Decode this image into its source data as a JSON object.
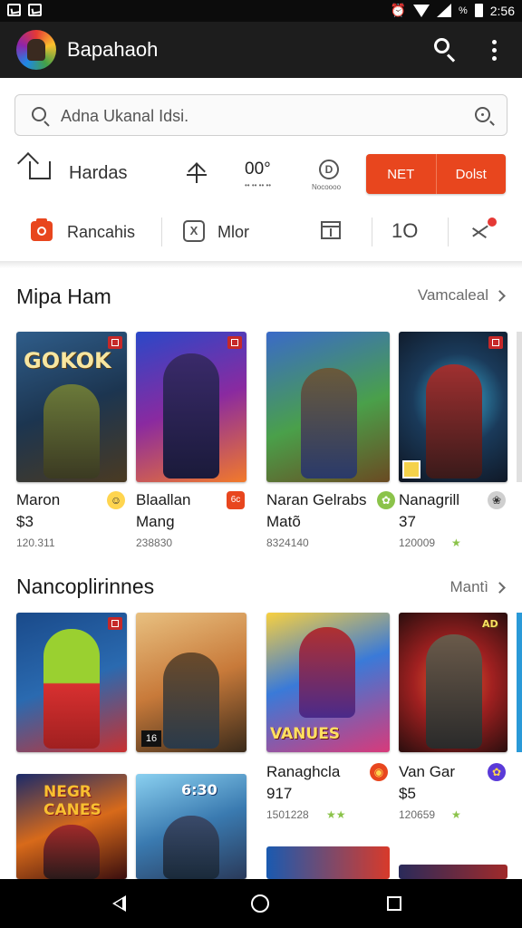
{
  "status_bar": {
    "time": "2:56",
    "battery": "%"
  },
  "app_bar": {
    "title": "Bapahaoh"
  },
  "search": {
    "placeholder": "Adna Ukanal Idsi."
  },
  "toolbar": {
    "home_label": "Hardas",
    "counter_text": "00°",
    "counter_sub": "•• •• •• ••",
    "d_icon": "D",
    "d_sub": "Nocoooo",
    "button_left": "NET",
    "button_right": "Dolst"
  },
  "categories": {
    "item1": "Rancahis",
    "item2": "Mlor",
    "x_icon": "X",
    "loop": "1O"
  },
  "sections": [
    {
      "title": "Mipa Ham",
      "more": "Vamcaleal",
      "cards": [
        {
          "title": "Maron",
          "sub": "$3",
          "count": "120.311",
          "emoji": "☺",
          "art": "GOKOK"
        },
        {
          "title": "Blaallan",
          "sub": "Mang",
          "count": "238830",
          "emoji": "6c"
        },
        {
          "title": "Naran Gelrabs",
          "sub": "Matõ",
          "count": "8324140",
          "emoji": "✿"
        },
        {
          "title": "Nanagrill",
          "sub": "37",
          "count": "120009",
          "emoji": "❀",
          "star": "★"
        }
      ]
    },
    {
      "title": "Nancoplirinnes",
      "more": "Mantì",
      "cards": [
        {
          "title": "",
          "sub": "",
          "count": ""
        },
        {
          "title": "",
          "sub": "",
          "count": "",
          "badge_text": "16"
        },
        {
          "title": "Ranaghcla",
          "sub": "917",
          "count": "1501228",
          "emoji": "◉",
          "star": "★★",
          "art": "VANUES"
        },
        {
          "title": "Van Gar",
          "sub": "$5",
          "count": "120659",
          "emoji": "✿",
          "star": "★",
          "art": "AD"
        }
      ]
    },
    {
      "cards": [
        {
          "art": "NEGR CANES"
        },
        {
          "art": "6:30"
        }
      ]
    }
  ],
  "nav": {
    "back": "back",
    "home": "home",
    "recent": "recent"
  },
  "colors": {
    "accent": "#e8461e",
    "appbar": "#1d1d1d",
    "statusbar": "#0c0c0c"
  }
}
